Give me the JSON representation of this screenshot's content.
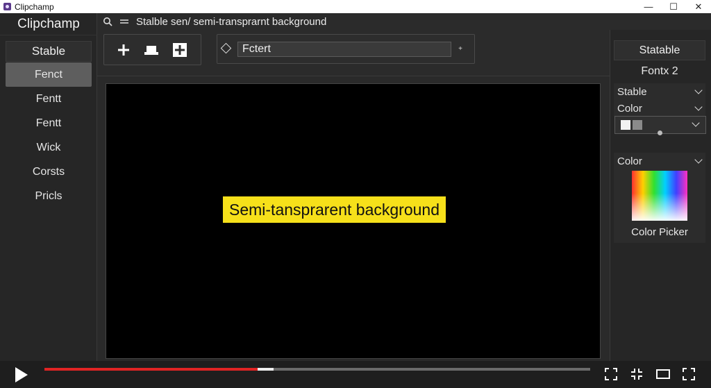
{
  "window": {
    "title": "Clipchamp",
    "controls": {
      "minimize": "—",
      "maximize": "☐",
      "close": "✕"
    }
  },
  "sidebar": {
    "brand": "Clipchamp",
    "header": "Stable",
    "items": [
      {
        "label": "Fenct",
        "active": true
      },
      {
        "label": "Fentt",
        "active": false
      },
      {
        "label": "Fentt",
        "active": false
      },
      {
        "label": "Wick",
        "active": false
      },
      {
        "label": "Corsts",
        "active": false
      },
      {
        "label": "Pricls",
        "active": false
      }
    ]
  },
  "header": {
    "title": "Stalble sen/ semi-transprarnt background",
    "icons": [
      "search-icon",
      "menu-icon"
    ]
  },
  "toolbar": {
    "buttons": [
      "add-icon",
      "text-block-icon",
      "add-box-icon"
    ],
    "font_field_value": "Fctert",
    "font_field_icon": "diamond-icon",
    "small_control": "+"
  },
  "canvas": {
    "background": "#000000",
    "caption_text": "Semi-tansprarent background",
    "caption_color": "#f6e01a"
  },
  "right_panel": {
    "header": "Statable",
    "subheader": "Fontx 2",
    "rows": [
      {
        "label": "Stable"
      },
      {
        "label": "Color"
      }
    ],
    "swatches": [
      "#f2f2f2",
      "#8a8a8a"
    ],
    "color_section_label": "Color",
    "picker_label": "Color Picker"
  },
  "player": {
    "progress": 0.39,
    "buffered": 0.42,
    "progress_color": "#e02424",
    "controls": [
      "play-icon",
      "fullscreen-icon",
      "collapse-icon",
      "theater-mode-icon",
      "expand-icon"
    ]
  }
}
